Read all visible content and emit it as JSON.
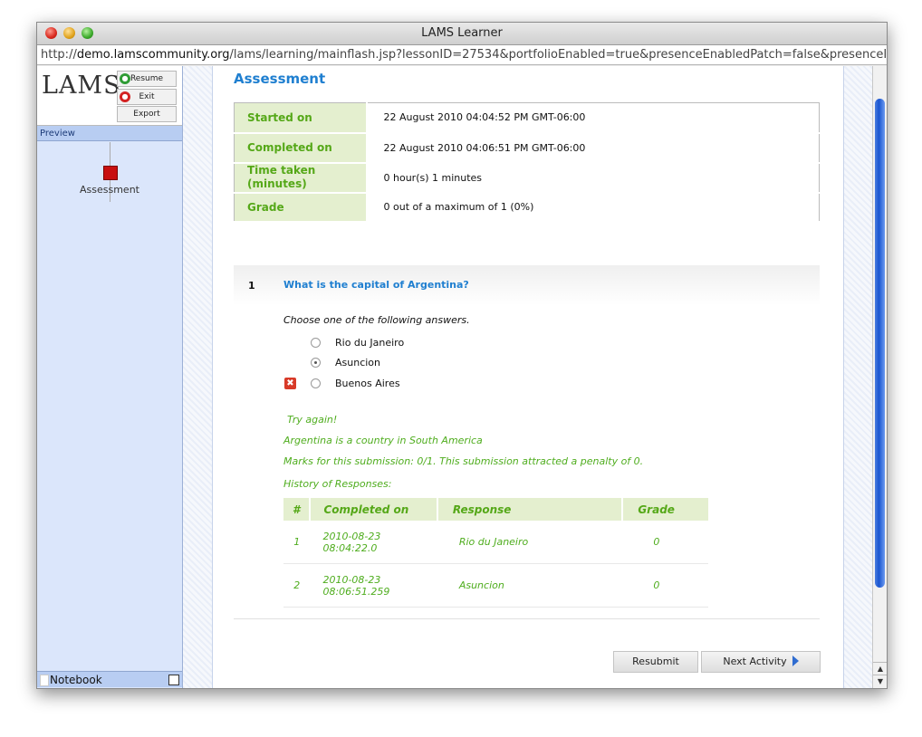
{
  "window": {
    "title": "LAMS Learner"
  },
  "address_bar": {
    "prefix": "http://",
    "host": "demo.lamscommunity.org",
    "path": "/lams/learning/mainflash.jsp?lessonID=27534&portfolioEnabled=true&presenceEnabledPatch=false&presenceImE"
  },
  "sidebar": {
    "logo": "LAMS",
    "buttons": {
      "resume": "Resume",
      "exit": "Exit",
      "export": "Export"
    },
    "preview_label": "Preview",
    "activity_label": "Assessment",
    "notebook_label": "Notebook"
  },
  "page": {
    "title": "Assessment",
    "summary": [
      {
        "label": "Started on",
        "value": "22 August 2010 04:04:52 PM GMT-06:00"
      },
      {
        "label": "Completed on",
        "value": "22 August 2010 04:06:51 PM GMT-06:00"
      },
      {
        "label": "Time taken (minutes)",
        "value": "0 hour(s) 1 minutes"
      },
      {
        "label": "Grade",
        "value": "0 out of a maximum of 1 (0%)"
      }
    ],
    "question": {
      "number": "1",
      "text": "What is the capital of Argentina?",
      "instruction": "Choose one of the following answers.",
      "options": [
        {
          "label": "Rio du Janeiro",
          "selected": false
        },
        {
          "label": "Asuncion",
          "selected": true
        },
        {
          "label": "Buenos Aires",
          "selected": false
        }
      ],
      "feedback": {
        "try_again": "Try again!",
        "hint": "Argentina is a country in South America",
        "marks": "Marks for this submission: 0/1. This submission attracted a penalty of 0.",
        "history_label": "History of Responses:"
      },
      "history": {
        "headers": [
          "#",
          "Completed on",
          "Response",
          "Grade"
        ],
        "rows": [
          {
            "num": "1",
            "date": "2010-08-23",
            "time": "08:04:22.0",
            "response": "Rio du Janeiro",
            "grade": "0"
          },
          {
            "num": "2",
            "date": "2010-08-23",
            "time": "08:06:51.259",
            "response": "Asuncion",
            "grade": "0"
          }
        ]
      }
    },
    "buttons": {
      "resubmit": "Resubmit",
      "next": "Next Activity"
    }
  },
  "colors": {
    "accent_blue": "#1f7fd0",
    "accent_green": "#55a818",
    "label_bg": "#e4efcf",
    "error_red": "#d83a28"
  }
}
